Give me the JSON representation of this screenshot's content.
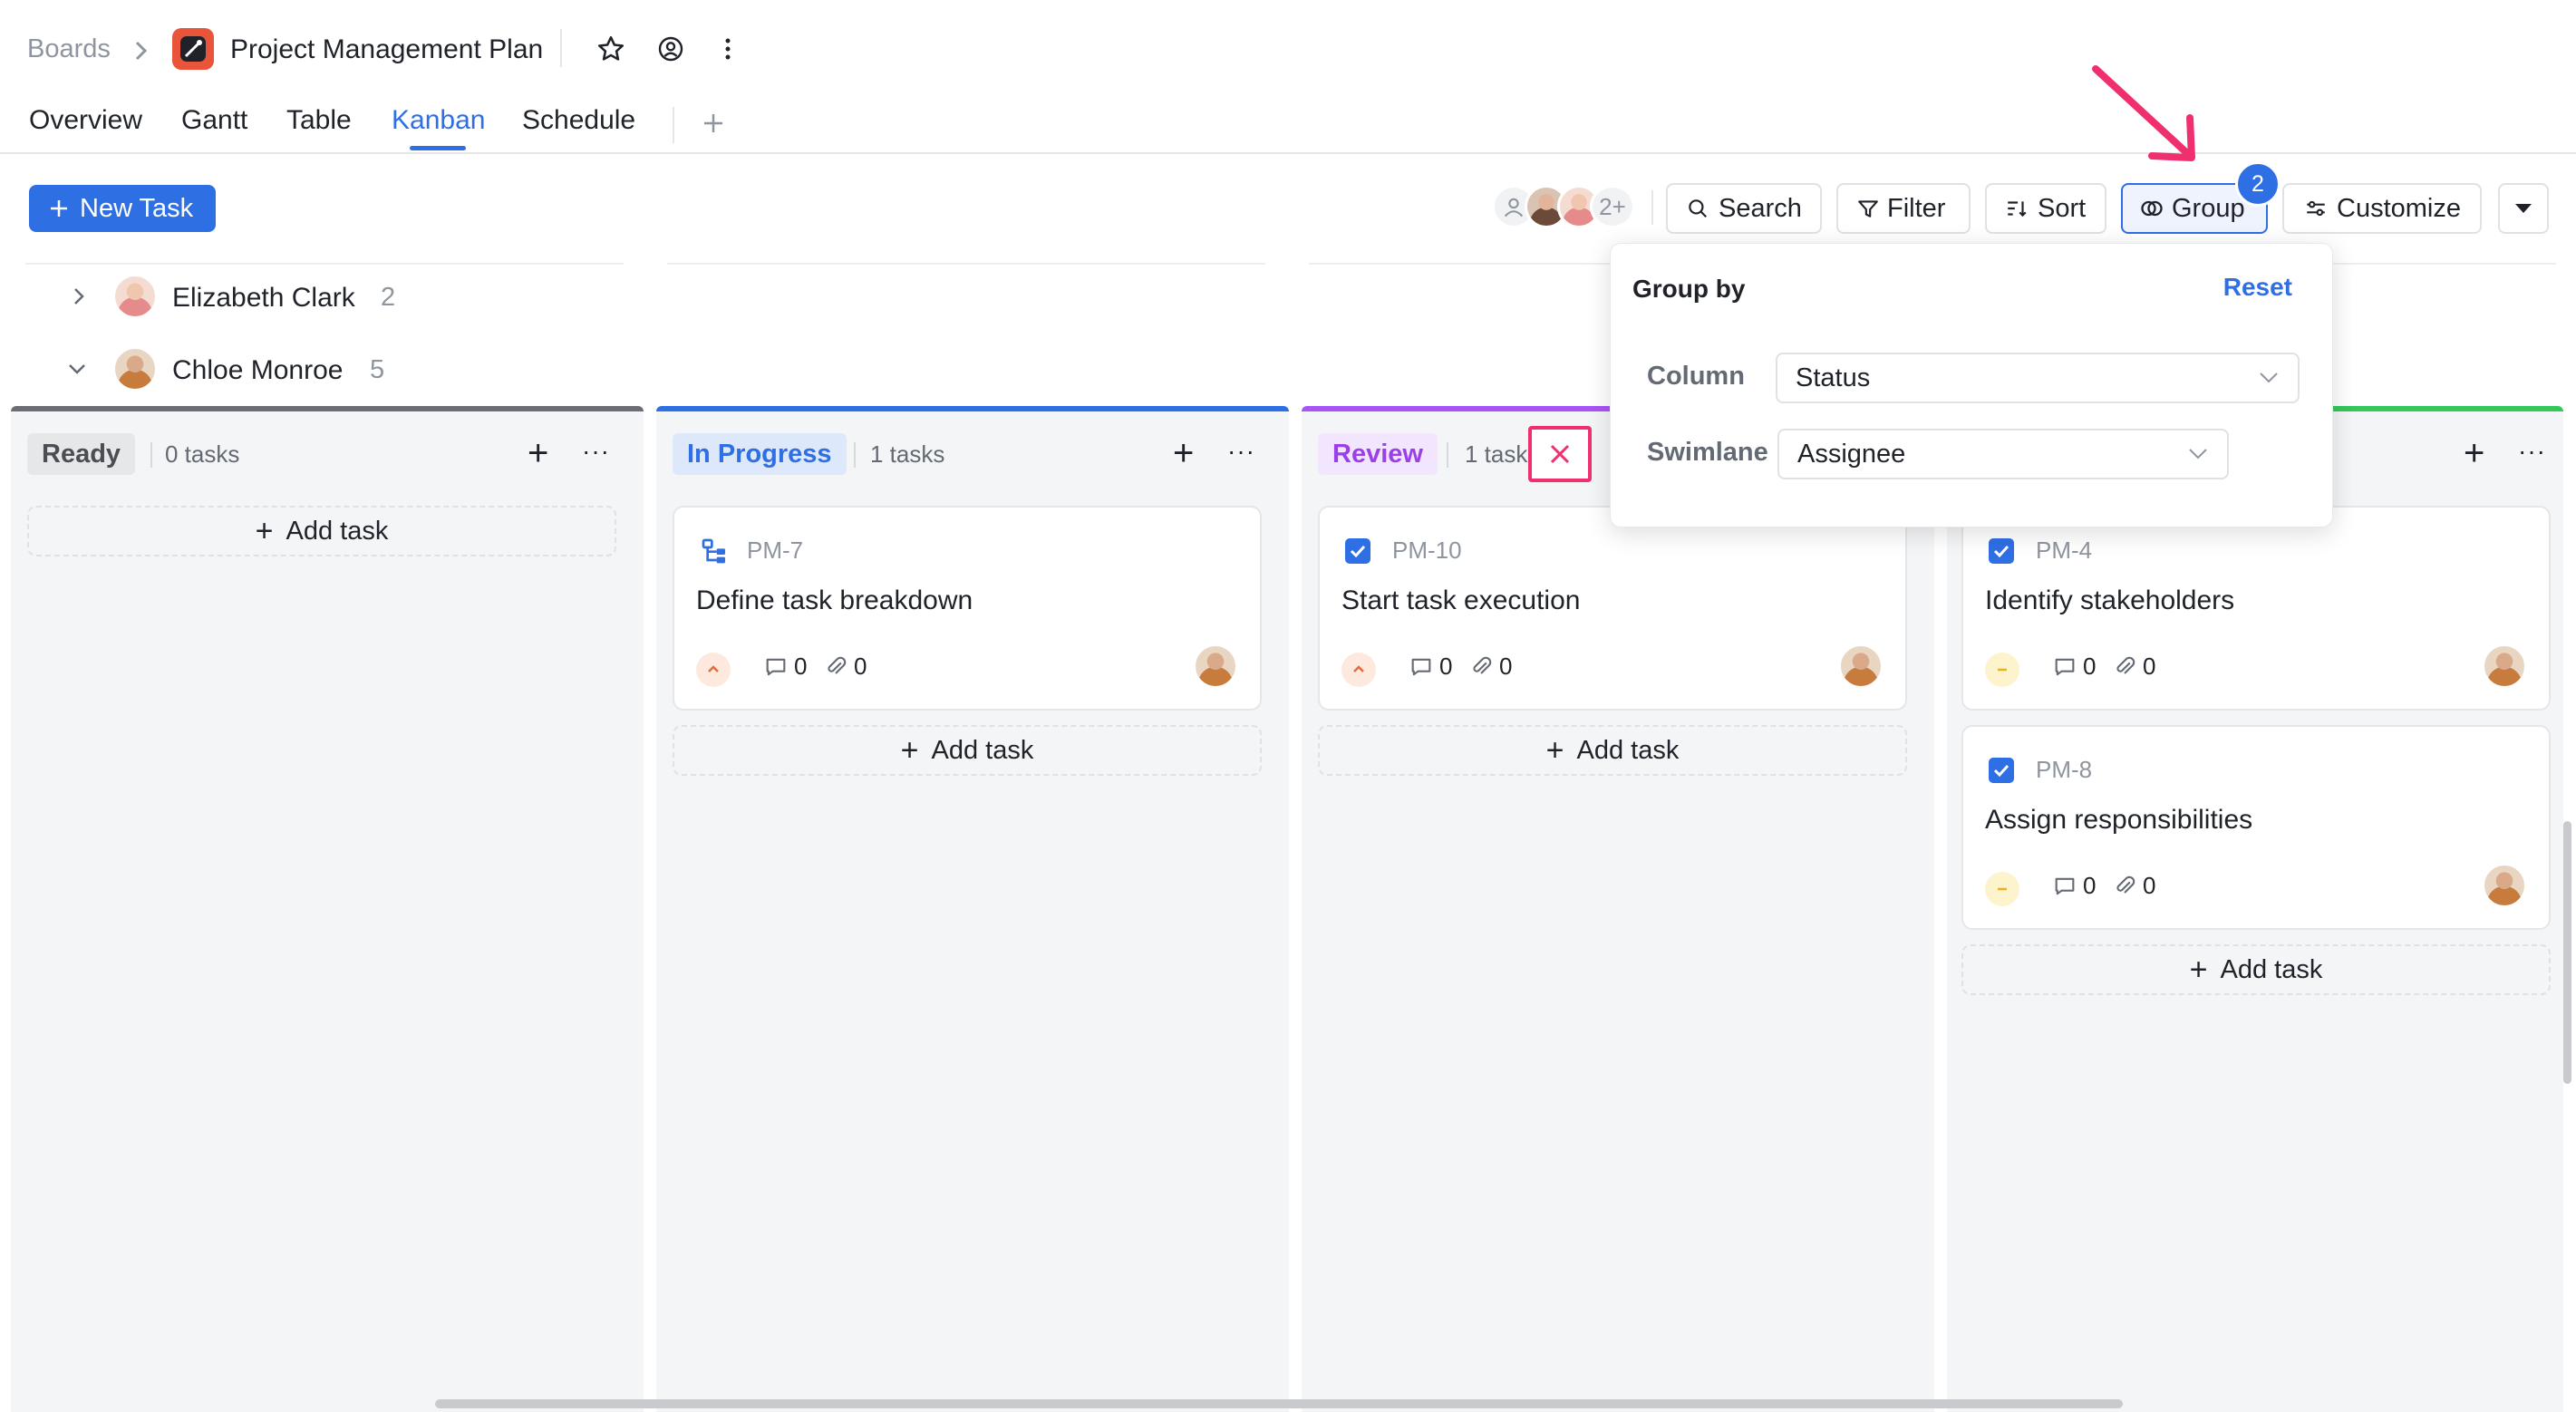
{
  "breadcrumb": {
    "root": "Boards",
    "project": "Project Management Plan"
  },
  "tabs": [
    "Overview",
    "Gantt",
    "Table",
    "Kanban",
    "Schedule"
  ],
  "active_tab": "Kanban",
  "toolbar": {
    "new_task": "New Task",
    "members_more": "2+",
    "search": "Search",
    "filter": "Filter",
    "sort": "Sort",
    "group": "Group",
    "group_badge": "2",
    "customize": "Customize"
  },
  "swimlanes": [
    {
      "name": "Elizabeth Clark",
      "count": "2",
      "expanded": false
    },
    {
      "name": "Chloe Monroe",
      "count": "5",
      "expanded": true
    }
  ],
  "columns": [
    {
      "label": "Ready",
      "count": "0 tasks",
      "accent": "#6b6e73",
      "label_bg": "#e6e7e9",
      "label_color": "#4a4d52",
      "add": "Add task"
    },
    {
      "label": "In Progress",
      "count": "1 tasks",
      "accent": "#2f6fe4",
      "label_bg": "#dde8fb",
      "label_color": "#2f6fe4",
      "add": "Add task"
    },
    {
      "label": "Review",
      "count": "1 tasks",
      "accent": "#a855f7",
      "label_bg": "#f1e6fd",
      "label_color": "#9b3fe8",
      "add": "Add task"
    },
    {
      "label": "",
      "count": "",
      "accent": "#34c759",
      "add": "Add task"
    }
  ],
  "cards": [
    {
      "id": "PM-7",
      "title": "Define task breakdown",
      "comments": "0",
      "attachments": "0",
      "priority": "high"
    },
    {
      "id": "PM-10",
      "title": "Start task execution",
      "comments": "0",
      "attachments": "0",
      "priority": "high"
    },
    {
      "id": "PM-4",
      "title": "Identify stakeholders",
      "comments": "0",
      "attachments": "0",
      "priority": "medium"
    },
    {
      "id": "PM-8",
      "title": "Assign responsibilities",
      "comments": "0",
      "attachments": "0",
      "priority": "medium"
    }
  ],
  "group_popover": {
    "title": "Group by",
    "reset": "Reset",
    "column_label": "Column",
    "column_value": "Status",
    "swimlane_label": "Swimlane",
    "swimlane_value": "Assignee"
  },
  "colors": {
    "accent": "#2f6fe4",
    "highlight": "#f0306e"
  }
}
